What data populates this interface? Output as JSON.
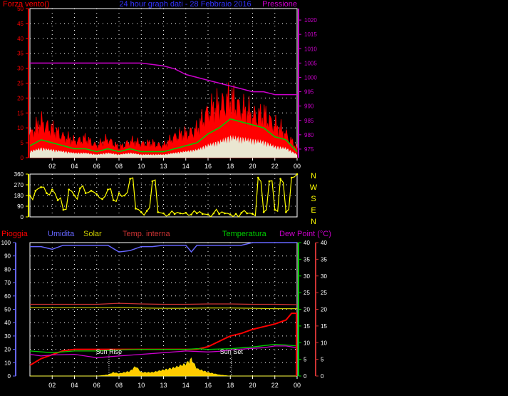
{
  "chart_data": [
    {
      "type": "line",
      "title": "24 hour graph dati - 28 Febbraio 2016",
      "labels": {
        "left": "Forza vento()",
        "right": "Pressione"
      },
      "x_ticks": [
        "02",
        "04",
        "06",
        "08",
        "10",
        "13",
        "14",
        "16",
        "18",
        "20",
        "22",
        "00"
      ],
      "y_left": {
        "ticks": [
          "0",
          "5",
          "10",
          "15",
          "20",
          "25",
          "30",
          "35",
          "40",
          "45",
          "50"
        ],
        "range": [
          0,
          50
        ]
      },
      "y_right": {
        "ticks": [
          "975",
          "980",
          "985",
          "990",
          "995",
          "1000",
          "1005",
          "1010",
          "1015",
          "1020"
        ],
        "range": [
          972,
          1024
        ]
      },
      "colors": {
        "gust": "#ff0000",
        "average": "#00cc00",
        "base": "#e8ffe8",
        "pressure": "#cc00cc",
        "left_axis": "#ff0000",
        "right_axis": "#cc00cc"
      },
      "series": [
        {
          "name": "Pressione",
          "x": [
            0,
            2,
            4,
            6,
            8,
            10,
            12,
            13,
            14,
            16,
            18,
            19,
            20,
            21,
            22,
            23,
            24
          ],
          "values": [
            1005,
            1005,
            1005,
            1005,
            1005,
            1005,
            1004,
            1003,
            1001,
            999,
            997,
            996,
            995,
            995,
            994,
            994,
            994
          ]
        },
        {
          "x": [
            0,
            1,
            2,
            3,
            4,
            5,
            6,
            7,
            8,
            9,
            10,
            11,
            12,
            13,
            14,
            15,
            16,
            17,
            18,
            19,
            20,
            21,
            22,
            23,
            24
          ],
          "values": [
            10,
            15,
            12,
            9,
            7,
            8,
            5,
            8,
            4,
            7,
            6,
            6,
            5,
            9,
            10,
            12,
            20,
            22,
            25,
            21,
            18,
            18,
            14,
            10,
            4
          ]
        },
        {
          "x": [
            0,
            1,
            2,
            3,
            4,
            5,
            6,
            7,
            8,
            9,
            10,
            11,
            12,
            13,
            14,
            15,
            16,
            17,
            18,
            19,
            20,
            21,
            22,
            23,
            24
          ],
          "values": [
            4,
            6,
            5,
            4,
            3,
            3,
            2,
            3,
            2,
            3,
            2,
            2,
            2,
            3,
            4,
            5,
            8,
            10,
            13,
            12,
            11,
            10,
            7,
            6,
            2
          ]
        }
      ]
    },
    {
      "type": "scatter",
      "y_ticks": [
        "0",
        "90",
        "180",
        "270",
        "360"
      ],
      "compass": [
        "N",
        "W",
        "S",
        "E",
        "N"
      ],
      "range": [
        0,
        360
      ],
      "color": "#ffff00",
      "x": [
        0,
        0.5,
        1,
        1.5,
        2,
        2.5,
        3,
        3.5,
        4,
        4.5,
        5,
        5.5,
        6,
        6.5,
        7,
        7.5,
        8,
        8.5,
        9,
        9.5,
        10,
        10.5,
        11,
        11.5,
        12,
        12.5,
        13,
        13.5,
        14,
        14.5,
        15,
        15.5,
        16,
        16.5,
        17,
        17.5,
        18,
        18.5,
        19,
        19.5,
        20,
        20.5,
        21,
        21.5,
        22,
        22.5,
        23,
        23.5,
        24
      ],
      "values": [
        180,
        220,
        250,
        200,
        230,
        140,
        60,
        230,
        180,
        240,
        200,
        220,
        190,
        150,
        230,
        140,
        200,
        180,
        320,
        70,
        40,
        50,
        300,
        40,
        30,
        20,
        25,
        30,
        35,
        20,
        30,
        25,
        20,
        30,
        25,
        30,
        20,
        25,
        35,
        30,
        25,
        330,
        40,
        300,
        60,
        320,
        40,
        330,
        360
      ]
    },
    {
      "type": "line",
      "legend": [
        "Pioggia",
        "Umidita",
        "Solar",
        "Temp. interna",
        "Temperatura",
        "Dew Point (°C)"
      ],
      "x_ticks": [
        "02",
        "04",
        "06",
        "08",
        "10",
        "13",
        "14",
        "16",
        "18",
        "20",
        "22",
        "00"
      ],
      "y_left": {
        "ticks": [
          "0",
          "10",
          "20",
          "30",
          "40",
          "50",
          "60",
          "70",
          "80",
          "90",
          "100"
        ],
        "range": [
          0,
          100
        ]
      },
      "y_right_green": {
        "ticks": [
          "0",
          "5",
          "10",
          "15",
          "20",
          "25",
          "30",
          "35",
          "40"
        ],
        "range": [
          0,
          40
        ]
      },
      "y_right_red": {
        "ticks": [
          "0",
          "5",
          "10",
          "15",
          "20",
          "25",
          "30",
          "35",
          "40"
        ],
        "range": [
          0,
          40
        ]
      },
      "annotations": [
        {
          "text": "Sun Rise",
          "hour": 7.1
        },
        {
          "text": "Sun Set",
          "hour": 18.1
        }
      ],
      "colors": {
        "rain": "#ff0000",
        "humidity": "#6666ff",
        "solar": "#cccc00",
        "temp_in": "#cc3333",
        "temp": "#00cc00",
        "dew": "#cc00cc",
        "solar_fill": "#ffcc00"
      },
      "series": [
        {
          "name": "Umidita",
          "x": [
            0,
            1,
            2,
            3,
            4,
            5,
            6,
            7,
            8,
            9,
            10,
            11,
            12,
            13,
            14,
            14.5,
            15,
            16,
            17,
            18,
            19,
            20,
            21,
            22,
            23,
            24
          ],
          "values": [
            97,
            97,
            95,
            98,
            98,
            98,
            98,
            98,
            93,
            94,
            97,
            97,
            98,
            98,
            98,
            93,
            98,
            98,
            98,
            98,
            98,
            100,
            100,
            100,
            100,
            100
          ]
        },
        {
          "name": "Temp. interna",
          "x": [
            0,
            2,
            4,
            6,
            8,
            10,
            12,
            14,
            16,
            18,
            20,
            22,
            24
          ],
          "values": [
            21.5,
            21.5,
            21.5,
            21.5,
            21.8,
            21.6,
            21.5,
            21.5,
            21.6,
            21.6,
            21.5,
            21.5,
            21.4
          ]
        },
        {
          "name": "Solar",
          "x": [
            0,
            2,
            4,
            6,
            8,
            10,
            12,
            14,
            16,
            18,
            20,
            22,
            24
          ],
          "values": [
            20.5,
            20.5,
            20.5,
            20.5,
            20.6,
            20.4,
            20.3,
            20.3,
            20.4,
            20.4,
            20.3,
            20.2,
            20.2
          ]
        },
        {
          "name": "Pioggia",
          "x": [
            0,
            1,
            2,
            3,
            4,
            6,
            8,
            10,
            12,
            14,
            15,
            16,
            17,
            17.5,
            18,
            19,
            20,
            21,
            22,
            23,
            23.5,
            24
          ],
          "values": [
            8,
            13,
            16,
            19,
            20,
            20,
            20,
            20,
            20,
            20,
            20,
            22,
            26,
            28,
            30,
            32,
            35,
            37,
            39,
            42,
            47,
            47
          ]
        },
        {
          "name": "Temperatura",
          "x": [
            0,
            2,
            4,
            6,
            8,
            10,
            12,
            14,
            15,
            16,
            18,
            20,
            22,
            23,
            24
          ],
          "values": [
            7.5,
            7,
            7.5,
            7.5,
            7.8,
            8,
            8,
            8,
            8.2,
            8,
            8.2,
            8.7,
            9.5,
            9.3,
            9
          ]
        },
        {
          "name": "Dew Point (°C)",
          "x": [
            0,
            1,
            2,
            4,
            6,
            8,
            10,
            12,
            14,
            16,
            17,
            18,
            20,
            21,
            22,
            23,
            24
          ],
          "values": [
            6.5,
            6,
            6.3,
            6.5,
            5.5,
            6,
            6.5,
            7,
            7.5,
            7.2,
            7.4,
            7.8,
            8.3,
            8.5,
            9,
            9,
            8.5
          ]
        },
        {
          "x": [
            0,
            6,
            7,
            7.5,
            8,
            9,
            9.5,
            10,
            11,
            12,
            13,
            14,
            14.5,
            15,
            16,
            17,
            18,
            24
          ],
          "values": [
            0,
            0,
            1,
            3,
            2,
            4,
            8,
            3,
            3,
            5,
            7,
            10,
            14,
            6,
            3,
            1,
            0,
            0
          ]
        }
      ]
    }
  ]
}
